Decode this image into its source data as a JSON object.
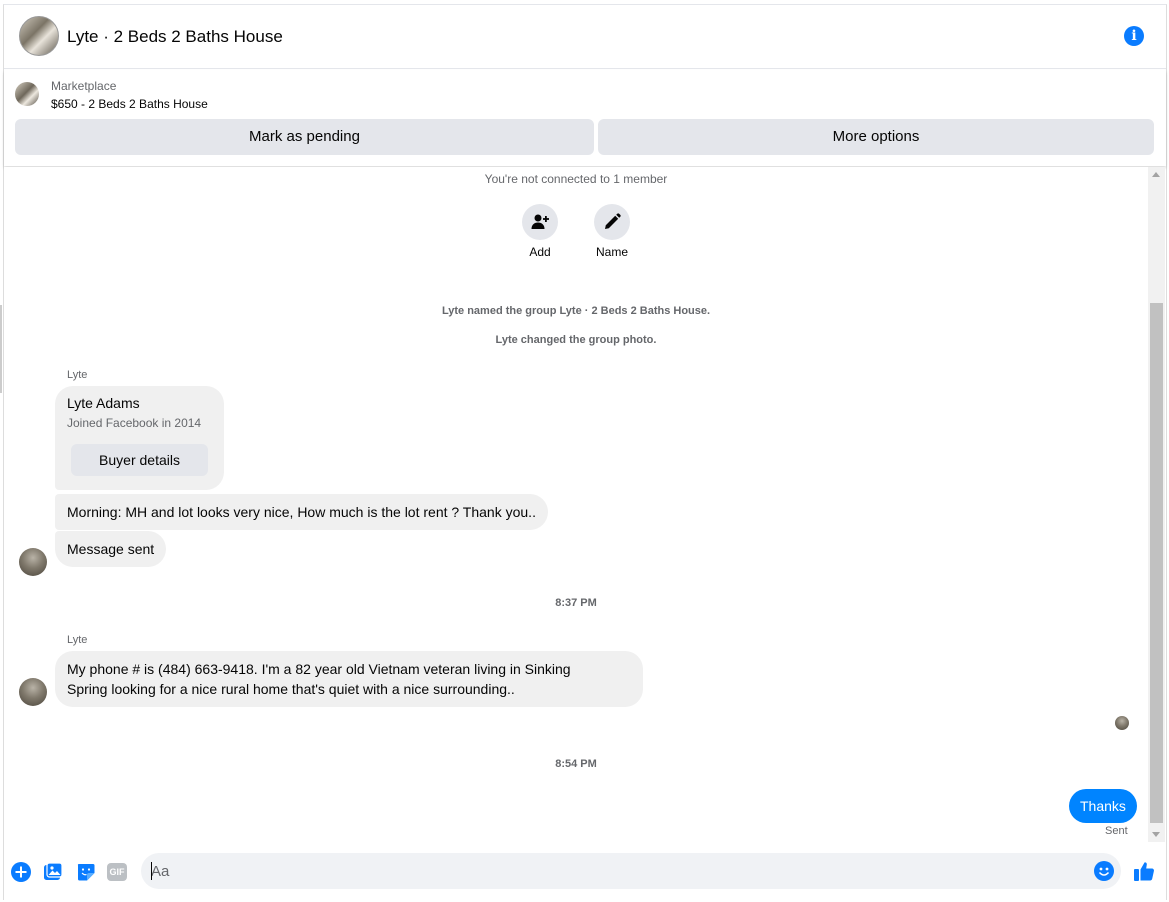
{
  "header": {
    "title": "Lyte · 2 Beds 2 Baths House"
  },
  "marketplace": {
    "label": "Marketplace",
    "listing": "$650 - 2 Beds 2 Baths House",
    "pending_button": "Mark as pending",
    "more_button": "More options"
  },
  "chat": {
    "connection_notice": "You're not connected to 1 member",
    "add_label": "Add",
    "name_label": "Name",
    "system_messages": [
      "Lyte named the group Lyte · 2 Beds 2 Baths House.",
      "Lyte changed the group photo."
    ],
    "sender_name": "Lyte",
    "card": {
      "name": "Lyte Adams",
      "joined": "Joined Facebook in 2014",
      "button": "Buyer details"
    },
    "messages": [
      "Morning:   MH and lot looks very nice, How much is the lot rent ?  Thank you..",
      "Message sent"
    ],
    "time_1": "8:37 PM",
    "sender_name_2": "Lyte",
    "message_long_line1": "My phone # is (484) 663-9418.  I'm a 82 year old Vietnam veteran living in Sinking",
    "message_long_line2": "Spring looking for a nice rural home that's quiet with a nice surrounding..",
    "time_2": "8:54 PM",
    "my_message": "Thanks",
    "sent_status": "Sent"
  },
  "composer": {
    "placeholder": "Aa",
    "gif_label": "GIF"
  },
  "colors": {
    "accent": "#0084ff",
    "icon_blue": "#0a7cff",
    "bubble_gray": "#f0f0f0",
    "button_gray": "#e4e6eb"
  },
  "icons": [
    "info-icon",
    "add-person-icon",
    "pencil-icon",
    "plus-icon",
    "photo-icon",
    "sticker-icon",
    "gif-icon",
    "emoji-icon",
    "thumbs-up-icon"
  ]
}
